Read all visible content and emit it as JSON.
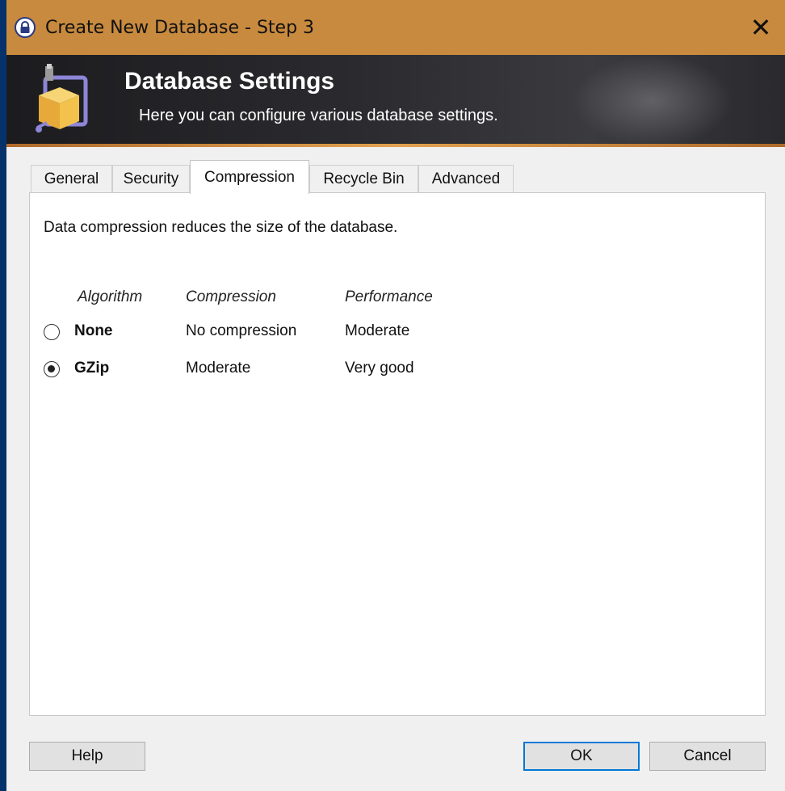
{
  "window": {
    "title": "Create New Database - Step 3",
    "close": "✕"
  },
  "banner": {
    "title": "Database Settings",
    "subtitle": "Here you can configure various database settings."
  },
  "tabs": [
    {
      "label": "General",
      "active": false
    },
    {
      "label": "Security",
      "active": false
    },
    {
      "label": "Compression",
      "active": true
    },
    {
      "label": "Recycle Bin",
      "active": false
    },
    {
      "label": "Advanced",
      "active": false
    }
  ],
  "compression": {
    "description": "Data compression reduces the size of the database.",
    "headers": {
      "algorithm": "Algorithm",
      "compression": "Compression",
      "performance": "Performance"
    },
    "options": [
      {
        "name": "None",
        "compression": "No compression",
        "performance": "Moderate",
        "selected": false
      },
      {
        "name": "GZip",
        "compression": "Moderate",
        "performance": "Very good",
        "selected": true
      }
    ]
  },
  "buttons": {
    "help": "Help",
    "ok": "OK",
    "cancel": "Cancel"
  },
  "icons": {
    "title": "lock-icon",
    "banner": "database-settings-icon"
  },
  "colors": {
    "titlebar": "#c88a3e",
    "desktop": "#06326c",
    "accent": "#0078d7"
  }
}
